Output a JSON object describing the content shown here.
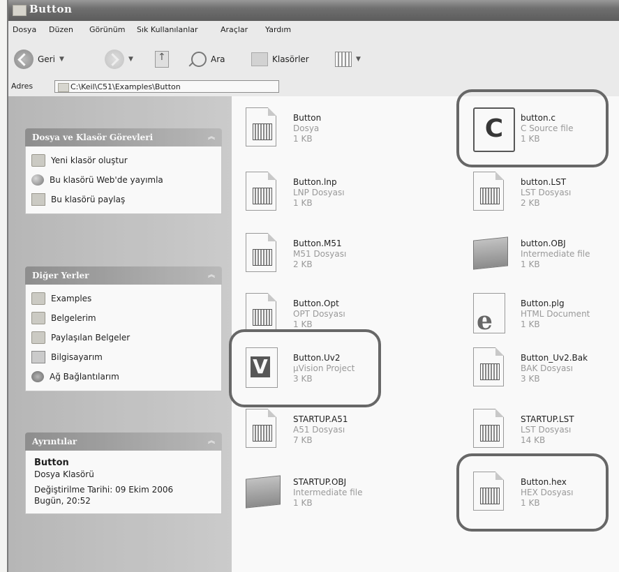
{
  "window": {
    "title": "Button"
  },
  "menu": [
    "Dosya",
    "Düzen",
    "Görünüm",
    "Sık Kullanılanlar",
    "Araçlar",
    "Yardım"
  ],
  "toolbar": {
    "back_label": "Geri",
    "search_label": "Ara",
    "folders_label": "Klasörler"
  },
  "address": {
    "label": "Adres",
    "path": "C:\\Keil\\C51\\Examples\\Button"
  },
  "tasks_panel": {
    "title": "Dosya ve Klasör Görevleri",
    "items": [
      "Yeni klasör oluştur",
      "Bu klasörü Web'de yayımla",
      "Bu klasörü paylaş"
    ]
  },
  "places_panel": {
    "title": "Diğer Yerler",
    "items": [
      "Examples",
      "Belgelerim",
      "Paylaşılan Belgeler",
      "Bilgisayarım",
      "Ağ Bağlantılarım"
    ]
  },
  "details_panel": {
    "title": "Ayrıntılar",
    "name": "Button",
    "type": "Dosya Klasörü",
    "modified": "Değiştirilme Tarihi: 09 Ekim 2006",
    "time": "Bugün, 20:52"
  },
  "files": [
    {
      "name": "Button",
      "type": "Dosya",
      "size": "1 KB",
      "icon": "generic-file-icon"
    },
    {
      "name": "button.c",
      "type": "C Source file",
      "size": "1 KB",
      "icon": "c-source-icon",
      "highlighted": true
    },
    {
      "name": "Button.lnp",
      "type": "LNP Dosyası",
      "size": "1 KB",
      "icon": "generic-file-icon"
    },
    {
      "name": "button.LST",
      "type": "LST Dosyası",
      "size": "2 KB",
      "icon": "generic-file-icon"
    },
    {
      "name": "Button.M51",
      "type": "M51 Dosyası",
      "size": "2 KB",
      "icon": "generic-file-icon"
    },
    {
      "name": "button.OBJ",
      "type": "Intermediate file",
      "size": "1 KB",
      "icon": "object-file-icon"
    },
    {
      "name": "Button.Opt",
      "type": "OPT Dosyası",
      "size": "1 KB",
      "icon": "generic-file-icon"
    },
    {
      "name": "Button.plg",
      "type": "HTML Document",
      "size": "1 KB",
      "icon": "html-document-icon"
    },
    {
      "name": "Button.Uv2",
      "type": "µVision Project",
      "size": "3 KB",
      "icon": "uvision-project-icon",
      "highlighted": true
    },
    {
      "name": "Button_Uv2.Bak",
      "type": "BAK Dosyası",
      "size": "3 KB",
      "icon": "generic-file-icon"
    },
    {
      "name": "STARTUP.A51",
      "type": "A51 Dosyası",
      "size": "7 KB",
      "icon": "generic-file-icon"
    },
    {
      "name": "STARTUP.LST",
      "type": "LST Dosyası",
      "size": "14 KB",
      "icon": "generic-file-icon"
    },
    {
      "name": "STARTUP.OBJ",
      "type": "Intermediate file",
      "size": "1 KB",
      "icon": "object-file-icon"
    },
    {
      "name": "Button.hex",
      "type": "HEX Dosyası",
      "size": "1 KB",
      "icon": "generic-file-icon",
      "highlighted": true
    }
  ]
}
